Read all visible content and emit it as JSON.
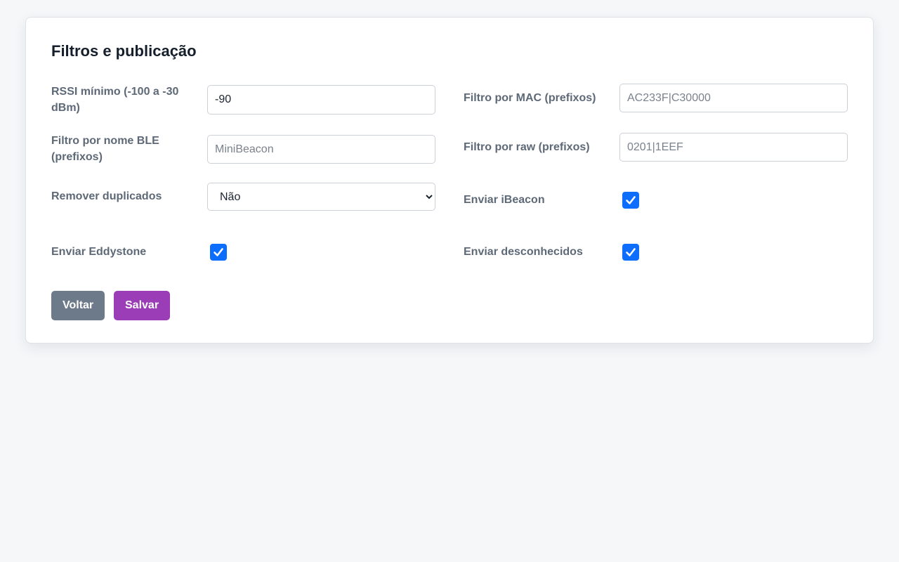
{
  "page": {
    "title": "Filtros e publicação"
  },
  "form": {
    "rssi": {
      "label": "RSSI mínimo (-100 a -30 dBm)",
      "value": "-90"
    },
    "mac_filter": {
      "label": "Filtro por MAC (prefixos)",
      "value": "",
      "placeholder": "AC233F|C30000"
    },
    "name_filter": {
      "label": "Filtro por nome BLE (prefixos)",
      "value": "",
      "placeholder": "MiniBeacon"
    },
    "raw_filter": {
      "label": "Filtro por raw (prefixos)",
      "value": "",
      "placeholder": "0201|1EEF"
    },
    "dedupe": {
      "label": "Remover duplicados",
      "selected": "Não"
    },
    "ibeacon": {
      "label": "Enviar iBeacon",
      "checked": true
    },
    "eddystone": {
      "label": "Enviar Eddystone",
      "checked": true
    },
    "unknown": {
      "label": "Enviar desconhecidos",
      "checked": true
    }
  },
  "actions": {
    "back_label": "Voltar",
    "save_label": "Salvar"
  },
  "colors": {
    "accent": "#0d6efd",
    "save_button": "#9b3db6",
    "back_button": "#6c7a89"
  }
}
